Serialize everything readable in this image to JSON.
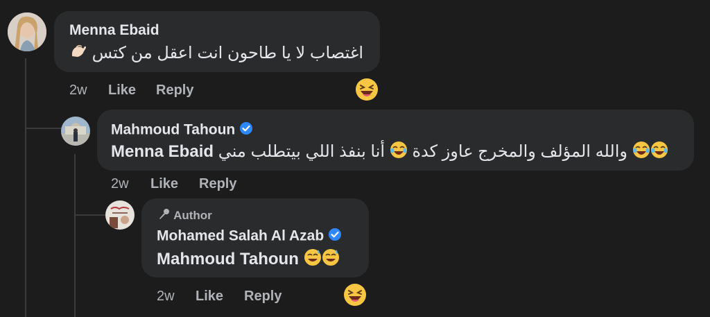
{
  "comments": [
    {
      "name": "Menna Ebaid",
      "text": "اغتصاب لا يا طاحون انت اعقل من كتس",
      "time": "2w",
      "like": "Like",
      "reply": "Reply"
    },
    {
      "name": "Mahmoud Tahoun",
      "mention": "Menna Ebaid",
      "text": "والله المؤلف والمخرج عاوز كدة",
      "text2": "أنا بنفذ اللي بيتطلب مني",
      "time": "2w",
      "like": "Like",
      "reply": "Reply"
    },
    {
      "badge": "Author",
      "name": "Mohamed Salah Al Azab",
      "mention": "Mahmoud Tahoun",
      "time": "2w",
      "like": "Like",
      "reply": "Reply"
    }
  ],
  "icons": {
    "reaction": "grinning-squinting-face-icon",
    "laugh": "tears-of-joy-icon",
    "sweat": "grinning-sweat-icon",
    "pinch": "pinching-hand-icon",
    "verified": "verified-badge-icon",
    "mic": "microphone-icon"
  },
  "colors": {
    "background": "#1c1c1d",
    "bubble": "#2a2b2c",
    "verified": "#2d88ff",
    "meta": "#b0b3b8"
  }
}
